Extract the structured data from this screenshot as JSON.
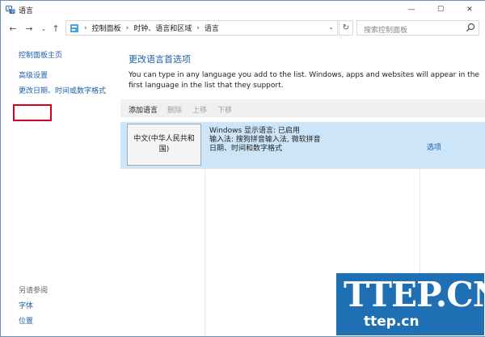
{
  "window": {
    "title": "语言",
    "controls": {
      "minimize": "—",
      "maximize": "☐",
      "close": "✕"
    }
  },
  "nav": {
    "back": "←",
    "forward": "→",
    "recent": "⌄",
    "up": "↑",
    "breadcrumb": [
      "控制面板",
      "时钟、语言和区域",
      "语言"
    ],
    "separator": "›",
    "address_dropdown": "⌄",
    "refresh": "↻",
    "search_placeholder": "搜索控制面板"
  },
  "sidebar": {
    "links": [
      {
        "label": "控制面板主页"
      },
      {
        "label": "高级设置",
        "highlighted": true
      },
      {
        "label": "更改日期、时间或数字格式"
      }
    ],
    "see_also_label": "另请参阅",
    "see_also_links": [
      {
        "label": "字体"
      },
      {
        "label": "位置"
      }
    ]
  },
  "main": {
    "title": "更改语言首选项",
    "description": "You can type in any language you add to the list. Windows, apps and websites will appear in the first language in the list that they support.",
    "toolbar": {
      "add": "添加语言",
      "remove": "删除",
      "move_up": "上移",
      "move_down": "下移"
    },
    "languages": [
      {
        "name": "中文(中华人民共和国)",
        "details": [
          "Windows 显示语言: 已启用",
          "输入法: 搜狗拼音输入法, 微软拼音",
          "日期、时间和数字格式"
        ],
        "options_label": "选项"
      }
    ]
  },
  "watermark": {
    "text_large": "TTEP.CN",
    "text_small": "ttep.cn"
  },
  "colors": {
    "link": "#1e5faa",
    "selection_row": "#cce5f8",
    "highlight_box": "#d2001f",
    "watermark_bg": "#1f6fb4"
  }
}
